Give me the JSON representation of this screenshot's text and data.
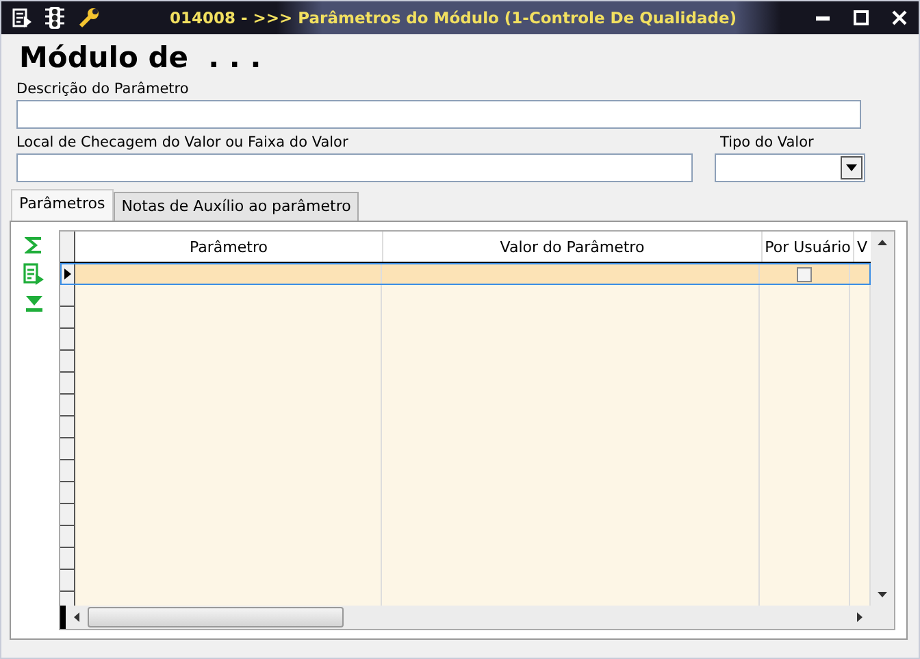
{
  "window": {
    "title": "014008 - >>> Parâmetros do Módulo (1-Controle De Qualidade)"
  },
  "heading": "Módulo de  . . .",
  "fields": [
    {
      "label": "Descrição do Parâmetro"
    },
    {
      "label": "Local de Checagem do Valor ou Faixa do Valor"
    },
    {
      "label": "Tipo do Valor"
    }
  ],
  "tabs": [
    {
      "label": "Parâmetros",
      "selected": true
    },
    {
      "label": "Notas de Auxílio ao parâmetro",
      "selected": false
    }
  ],
  "table": {
    "columns": [
      "Parâmetro",
      "Valor do Parâmetro",
      "Por Usuário",
      "V"
    ],
    "rows": [
      {
        "selected": true,
        "por_usuario": false
      }
    ]
  }
}
